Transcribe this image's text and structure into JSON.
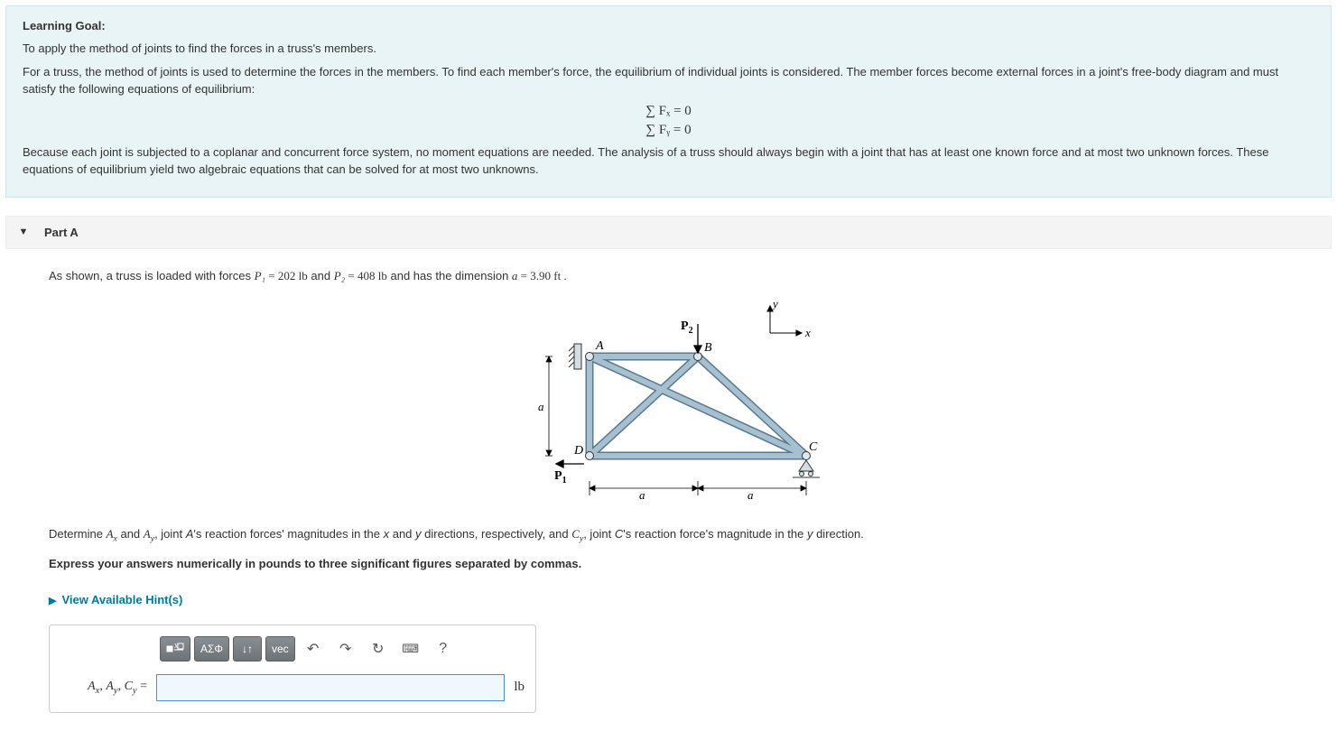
{
  "learning_goal": {
    "heading": "Learning Goal:",
    "intro": "To apply the method of joints to find the forces in a truss's members.",
    "body1": "For a truss, the method of joints is used to determine the forces in the members. To find each member's force, the equilibrium of individual joints is considered. The member forces become external forces in a joint's free-body diagram and must satisfy the following equations of equilibrium:",
    "eq1": "∑ Fₓ = 0",
    "eq2": "∑ Fᵧ = 0",
    "body2": "Because each joint is subjected to a coplanar and concurrent force system, no moment equations are needed. The analysis of a truss should always begin with a joint that has at least one known force and at most two unknown forces. These equations of equilibrium yield two algebraic equations that can be solved for at most two unknowns."
  },
  "partA": {
    "title": "Part A",
    "given_pre": "As shown, a truss is loaded with forces ",
    "P1_label": "P₁",
    "P1_val": " = 202 lb",
    "and1": " and ",
    "P2_label": "P₂",
    "P2_val": " = 408 lb",
    "given_post": " and has the dimension ",
    "a_label": "a",
    "a_val": " = 3.90 ft .",
    "determine": "Determine Aₓ and Aᵧ, joint A's reaction forces' magnitudes in the x and y directions, respectively, and Cᵧ, joint C's reaction force's magnitude in the y direction.",
    "express": "Express your answers numerically in pounds to three significant figures separated by commas.",
    "hints": "View Available Hint(s)",
    "answer_label": "Aₓ, Aᵧ, Cᵧ =",
    "unit": "lb"
  },
  "toolbar": {
    "templates_icon": "templates-icon",
    "greek_label": "ΑΣΦ",
    "updown_label": "↓↑",
    "vec_label": "vec",
    "undo_icon": "↶",
    "redo_icon": "↷",
    "reset_icon": "↻",
    "keyboard_icon": "⌨",
    "help_icon": "?"
  },
  "figure": {
    "labels": {
      "A": "A",
      "B": "B",
      "C": "C",
      "D": "D",
      "P1": "P₁",
      "P2": "P₂",
      "a": "a",
      "x": "x",
      "y": "y"
    }
  }
}
